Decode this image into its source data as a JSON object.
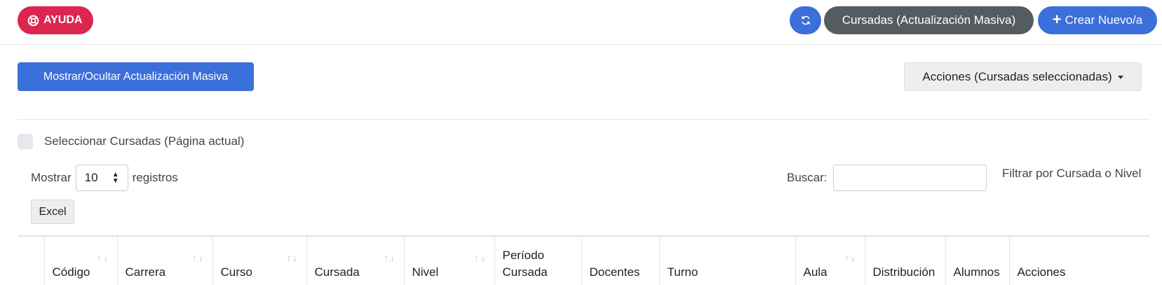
{
  "header": {
    "help_label": "AYUDA",
    "massive_update_label": "Cursadas (Actualización Masiva)",
    "create_label": "Crear Nuevo/a",
    "colors": {
      "help": "#dc2650",
      "primary": "#3b6fd9",
      "secondary": "#555c61"
    }
  },
  "toolbar": {
    "toggle_massive_label": "Mostrar/Ocultar Actualización Masiva",
    "actions_label": "Acciones (Cursadas seleccionadas)"
  },
  "selection": {
    "select_all_label": "Seleccionar Cursadas (Página actual)"
  },
  "length_menu": {
    "prefix": "Mostrar",
    "value": "10",
    "suffix": "registros"
  },
  "search": {
    "label": "Buscar:",
    "value": "",
    "hint": "Filtrar por Cursada o Nivel"
  },
  "export": {
    "excel_label": "Excel"
  },
  "table": {
    "columns": [
      {
        "label": "",
        "sortable": false
      },
      {
        "label": "Código",
        "sortable": true
      },
      {
        "label": "Carrera",
        "sortable": true
      },
      {
        "label": "Curso",
        "sortable": true
      },
      {
        "label": "Cursada",
        "sortable": true
      },
      {
        "label": "Nivel",
        "sortable": true
      },
      {
        "label": "Período Cursada",
        "sortable": false
      },
      {
        "label": "Docentes",
        "sortable": false
      },
      {
        "label": "Turno",
        "sortable": false
      },
      {
        "label": "Aula",
        "sortable": true
      },
      {
        "label": "Distribución",
        "sortable": false
      },
      {
        "label": "Alumnos",
        "sortable": false
      },
      {
        "label": "Acciones",
        "sortable": false
      }
    ]
  }
}
